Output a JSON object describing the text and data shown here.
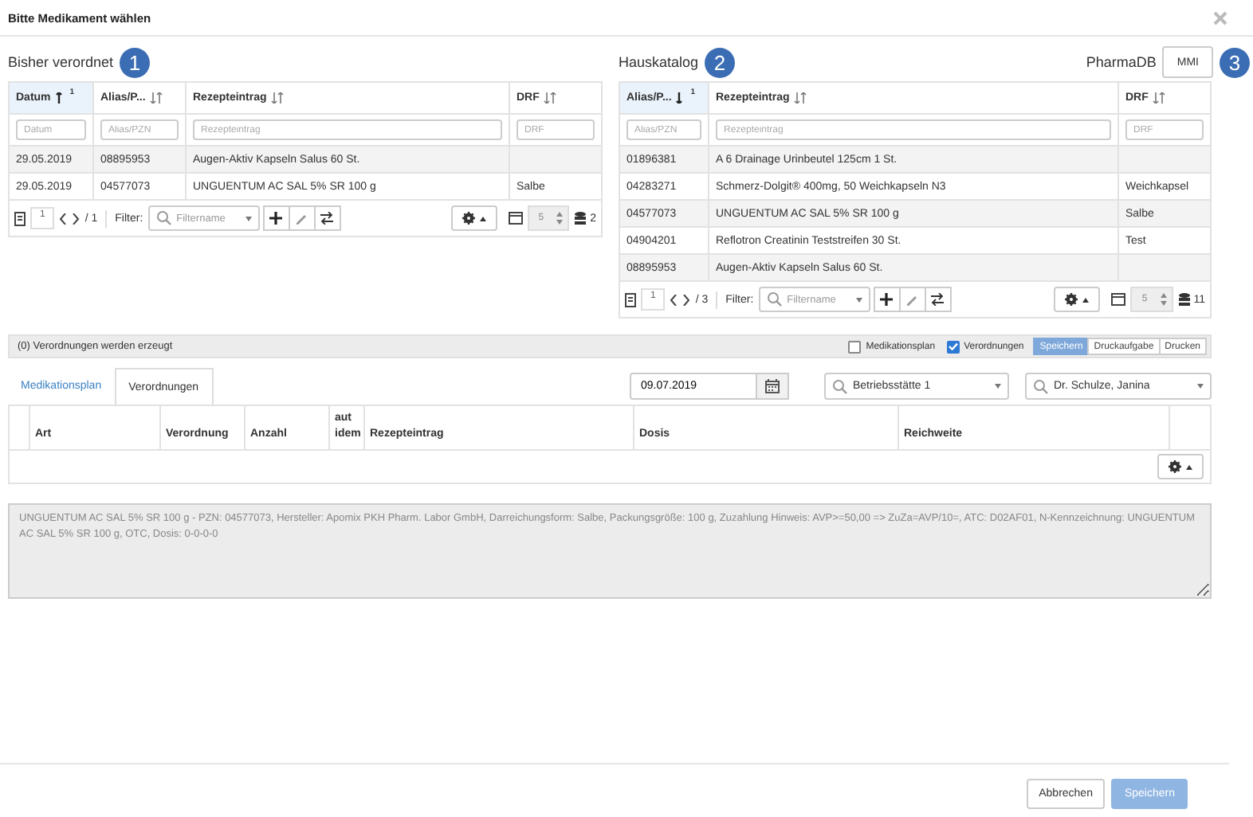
{
  "window": {
    "title": "Bitte Medikament wählen"
  },
  "panels": [
    {
      "title": "Bisher verordnet",
      "badge": "1",
      "kind": "history",
      "columns": [
        {
          "label": "Datum",
          "sorted": true,
          "descending": false,
          "sort_rank": "1",
          "placeholder": "Datum"
        },
        {
          "label": "Alias/P...",
          "sorted": false,
          "placeholder": "Alias/PZN"
        },
        {
          "label": "Rezepteintrag",
          "sorted": false,
          "placeholder": "Rezepteintrag"
        },
        {
          "label": "DRF",
          "sorted": false,
          "placeholder": "DRF"
        }
      ],
      "rows": [
        [
          "29.05.2019",
          "08895953",
          "Augen-Aktiv Kapseln Salus 60 St.",
          ""
        ],
        [
          "29.05.2019",
          "04577073",
          "UNGUENTUM AC SAL 5% SR 100 g",
          "Salbe"
        ]
      ],
      "pager": {
        "page": "1",
        "pages": "/ 1",
        "filter_label": "Filter:",
        "filter_placeholder": "Filtername",
        "page_size": "5",
        "count": "2"
      }
    },
    {
      "title": "Hauskatalog",
      "badge": "2",
      "kind": "catalog",
      "source_label": "PharmaDB",
      "source_button": "MMI",
      "source_badge": "3",
      "columns": [
        {
          "label": "Alias/P...",
          "sorted": true,
          "descending": true,
          "sort_rank": "1",
          "placeholder": "Alias/PZN"
        },
        {
          "label": "Rezepteintrag",
          "sorted": false,
          "placeholder": "Rezepteintrag"
        },
        {
          "label": "DRF",
          "sorted": false,
          "placeholder": "DRF"
        }
      ],
      "rows": [
        [
          "01896381",
          "A 6 Drainage Urinbeutel 125cm 1 St.",
          ""
        ],
        [
          "04283271",
          "Schmerz-Dolgit® 400mg, 50 Weichkapseln N3",
          "Weichkapsel"
        ],
        [
          "04577073",
          "UNGUENTUM AC SAL 5% SR 100 g",
          "Salbe"
        ],
        [
          "04904201",
          "Reflotron Creatinin Teststreifen 30 St.",
          "Test"
        ],
        [
          "08895953",
          "Augen-Aktiv Kapseln Salus 60 St.",
          ""
        ]
      ],
      "pager": {
        "page": "1",
        "pages": "/ 3",
        "filter_label": "Filter:",
        "filter_placeholder": "Filtername",
        "page_size": "5",
        "count": "11"
      }
    }
  ],
  "status_bar": {
    "text": "(0) Verordnungen werden erzeugt",
    "checkboxes": [
      {
        "label": "Medikationsplan",
        "checked": false
      },
      {
        "label": "Verordnungen",
        "checked": true
      }
    ],
    "buttons": [
      {
        "label": "Speichern",
        "selected": true
      },
      {
        "label": "Druckaufgabe",
        "selected": false
      },
      {
        "label": "Drucken",
        "selected": false
      }
    ]
  },
  "tabs": [
    {
      "label": "Medikationsplan",
      "selected": false
    },
    {
      "label": "Verordnungen",
      "selected": true
    }
  ],
  "date": {
    "value": "09.07.2019"
  },
  "selects": [
    {
      "value": "Betriebsstätte 1"
    },
    {
      "value": "Dr. Schulze, Janina"
    }
  ],
  "orders_table": {
    "columns": [
      "Art",
      "Verordnung",
      "Anzahl",
      "aut idem",
      "Rezepteintrag",
      "Dosis",
      "Reichweite"
    ]
  },
  "details": {
    "value": "UNGUENTUM AC SAL 5% SR 100 g - PZN: 04577073, Hersteller: Apomix PKH Pharm. Labor GmbH, Darreichungsform: Salbe, Packungsgröße: 100 g, Zuzahlung Hinweis: AVP>=50,00 => ZuZa=AVP/10=, ATC: D02AF01, N-Kennzeichnung: UNGUENTUM AC SAL 5% SR 100 g, OTC, Dosis: 0-0-0-0",
    "disabled": true
  },
  "footer": {
    "buttons": [
      {
        "label": "Abbrechen",
        "kind": "default",
        "disabled": false
      },
      {
        "label": "Speichern",
        "kind": "primary",
        "disabled": true
      }
    ]
  }
}
